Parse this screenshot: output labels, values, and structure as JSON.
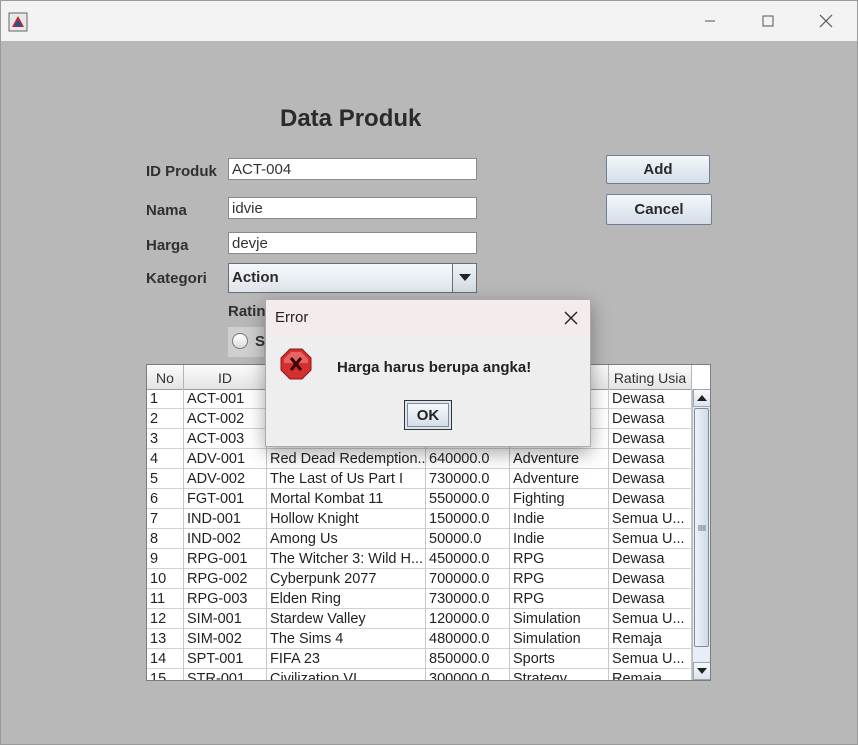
{
  "form": {
    "heading": "Data Produk",
    "id_label": "ID Produk",
    "id_value": "ACT-004",
    "nama_label": "Nama",
    "nama_value": "idvie",
    "harga_label": "Harga",
    "harga_value": "devje",
    "kategori_label": "Kategori",
    "kategori_value": "Action",
    "rating_label": "Ratin",
    "radio_label": "S",
    "add_label": "Add",
    "cancel_label": "Cancel"
  },
  "table": {
    "columns": [
      "No",
      "ID",
      "",
      "",
      "",
      "Rating Usia"
    ],
    "rows": [
      [
        "1",
        "ACT-001",
        "",
        "",
        "",
        "Dewasa"
      ],
      [
        "2",
        "ACT-002",
        "",
        "",
        "",
        "Dewasa"
      ],
      [
        "3",
        "ACT-003",
        "",
        "",
        "",
        "Dewasa"
      ],
      [
        "4",
        "ADV-001",
        "Red Dead Redemption...",
        "640000.0",
        "Adventure",
        "Dewasa"
      ],
      [
        "5",
        "ADV-002",
        "The Last of Us Part I",
        "730000.0",
        "Adventure",
        "Dewasa"
      ],
      [
        "6",
        "FGT-001",
        "Mortal Kombat 11",
        "550000.0",
        "Fighting",
        "Dewasa"
      ],
      [
        "7",
        "IND-001",
        "Hollow Knight",
        "150000.0",
        "Indie",
        "Semua U..."
      ],
      [
        "8",
        "IND-002",
        "Among Us",
        "50000.0",
        "Indie",
        "Semua U..."
      ],
      [
        "9",
        "RPG-001",
        "The Witcher 3: Wild H...",
        "450000.0",
        "RPG",
        "Dewasa"
      ],
      [
        "10",
        "RPG-002",
        "Cyberpunk 2077",
        "700000.0",
        "RPG",
        "Dewasa"
      ],
      [
        "11",
        "RPG-003",
        "Elden Ring",
        "730000.0",
        "RPG",
        "Dewasa"
      ],
      [
        "12",
        "SIM-001",
        "Stardew Valley",
        "120000.0",
        "Simulation",
        "Semua U..."
      ],
      [
        "13",
        "SIM-002",
        "The Sims 4",
        "480000.0",
        "Simulation",
        "Remaja"
      ],
      [
        "14",
        "SPT-001",
        "FIFA 23",
        "850000.0",
        "Sports",
        "Semua U..."
      ],
      [
        "15",
        "STR-001",
        "Civilization VI",
        "300000.0",
        "Strategy",
        "Remaja"
      ]
    ]
  },
  "dialog": {
    "title": "Error",
    "message": "Harga harus berupa angka!",
    "ok_label": "OK",
    "icon": "error-icon"
  },
  "colors": {
    "background": "#b8b8b8",
    "dialog_title": "#f4ecec",
    "error_red": "#d32f2f"
  }
}
